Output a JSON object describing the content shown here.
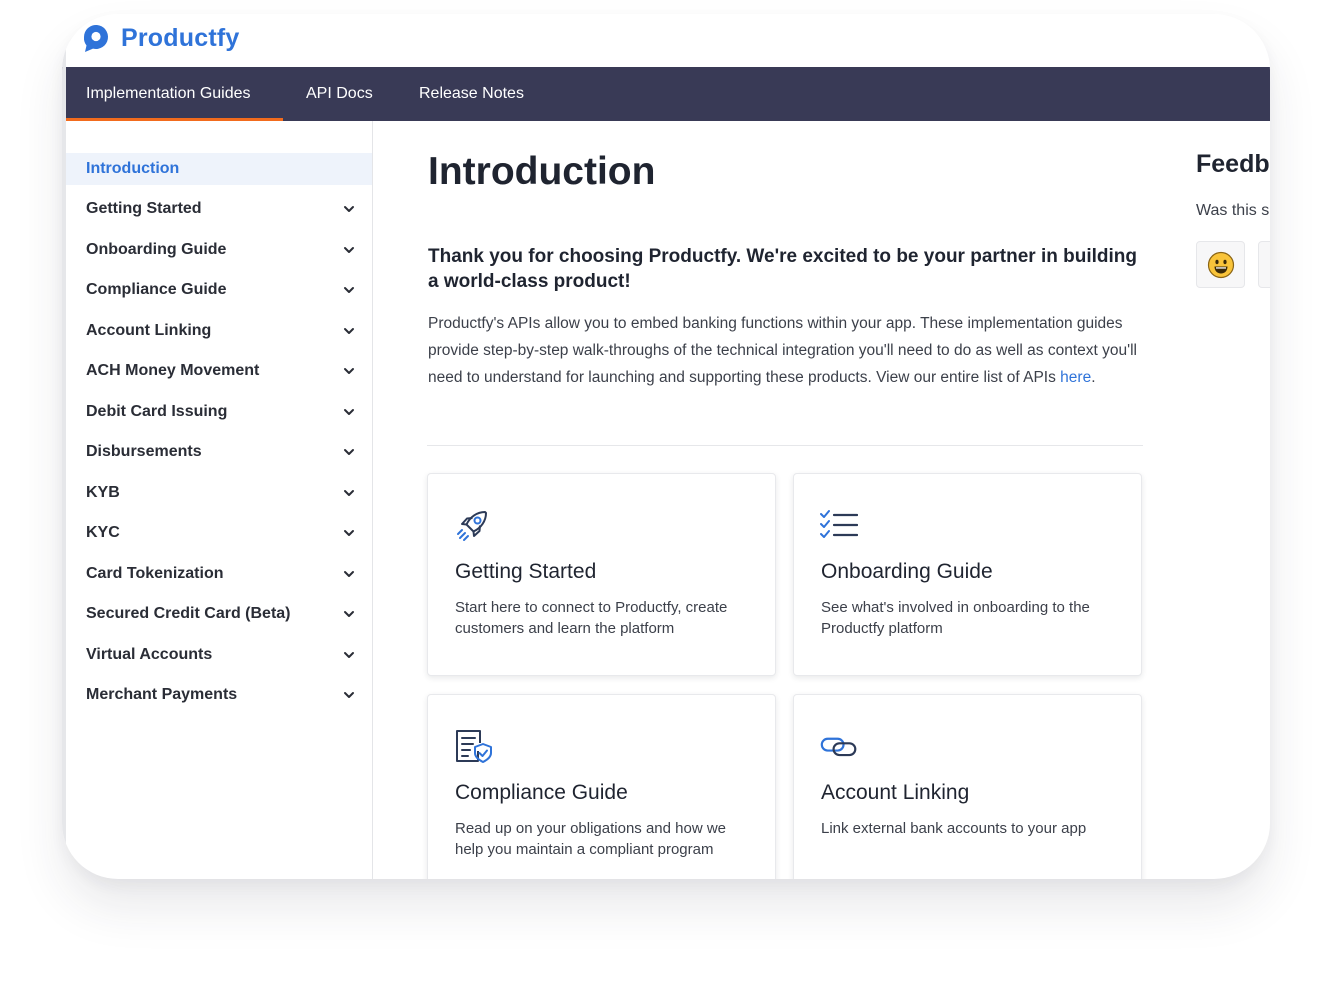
{
  "brand": {
    "name": "Productfy",
    "accent": "#2f73d9"
  },
  "nav": {
    "background": "#393a56",
    "active_indicator": "#f26b1d",
    "tabs": [
      {
        "label": "Implementation Guides",
        "active": true
      },
      {
        "label": "API Docs",
        "active": false
      },
      {
        "label": "Release Notes",
        "active": false
      }
    ]
  },
  "sidebar": {
    "items": [
      {
        "label": "Introduction",
        "active": true,
        "expandable": false
      },
      {
        "label": "Getting Started",
        "expandable": true
      },
      {
        "label": "Onboarding Guide",
        "expandable": true
      },
      {
        "label": "Compliance Guide",
        "expandable": true
      },
      {
        "label": "Account Linking",
        "expandable": true
      },
      {
        "label": "ACH Money Movement",
        "expandable": true
      },
      {
        "label": "Debit Card Issuing",
        "expandable": true
      },
      {
        "label": "Disbursements",
        "expandable": true
      },
      {
        "label": "KYB",
        "expandable": true
      },
      {
        "label": "KYC",
        "expandable": true
      },
      {
        "label": "Card Tokenization",
        "expandable": true
      },
      {
        "label": "Secured Credit Card (Beta)",
        "expandable": true
      },
      {
        "label": "Virtual Accounts",
        "expandable": true
      },
      {
        "label": "Merchant Payments",
        "expandable": true
      }
    ]
  },
  "main": {
    "title": "Introduction",
    "lead": "Thank you for choosing Productfy. We're excited to be your partner in building a world-class product!",
    "body": "Productfy's APIs allow you to embed banking functions within your app. These implementation guides provide step-by-step walk-throughs of the technical integration you'll need to do as well as context you'll need to understand for launching and supporting these products. View our entire list of APIs ",
    "body_link": "here",
    "body_end": ".",
    "cards": [
      {
        "title": "Getting Started",
        "description": "Start here to connect to Productfy, create customers and learn the platform",
        "icon": "rocket-icon"
      },
      {
        "title": "Onboarding Guide",
        "description": "See what's involved in onboarding to the Productfy platform",
        "icon": "checklist-icon"
      },
      {
        "title": "Compliance Guide",
        "description": "Read up on your obligations and how we help you maintain a compliant program",
        "icon": "document-shield-icon"
      },
      {
        "title": "Account Linking",
        "description": "Link external bank accounts to your app",
        "icon": "link-icon"
      }
    ]
  },
  "feedback": {
    "title": "Feedb",
    "subtitle": "Was this s",
    "buttons": [
      "smile-emoji-icon",
      "second-feedback-button"
    ]
  }
}
